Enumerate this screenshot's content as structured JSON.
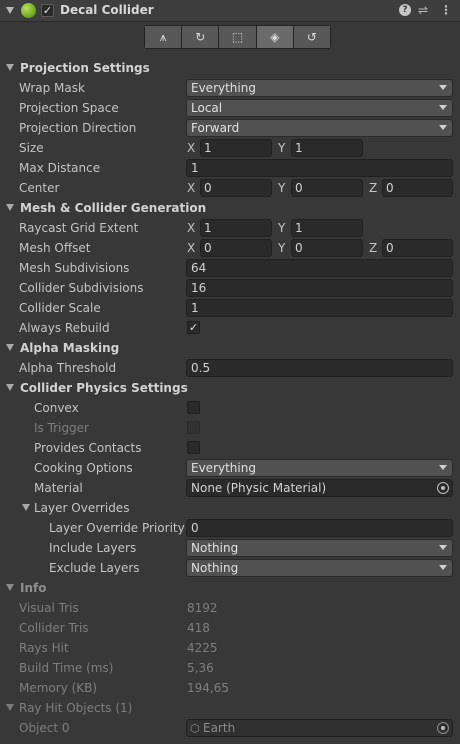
{
  "component": {
    "title": "Decal Collider",
    "enabled": true,
    "help_icon": "help-icon",
    "settings_icon": "settings-sliders-icon",
    "more_icon": "more-vertical-icon"
  },
  "toolbar": {
    "tools": [
      {
        "icon": "vertex-edit-icon",
        "glyph": "⩚"
      },
      {
        "icon": "rotate-icon",
        "glyph": "↻"
      },
      {
        "icon": "rect-tool-icon",
        "glyph": "⬚"
      },
      {
        "icon": "decal-projector-icon",
        "glyph": "◈"
      },
      {
        "icon": "refresh-icon",
        "glyph": "↺"
      }
    ]
  },
  "projection": {
    "title": "Projection Settings",
    "wrap_mask": {
      "label": "Wrap Mask",
      "value": "Everything"
    },
    "projection_space": {
      "label": "Projection Space",
      "value": "Local"
    },
    "projection_direction": {
      "label": "Projection Direction",
      "value": "Forward"
    },
    "size": {
      "label": "Size",
      "x": "1",
      "y": "1"
    },
    "max_distance": {
      "label": "Max Distance",
      "value": "1"
    },
    "center": {
      "label": "Center",
      "x": "0",
      "y": "0",
      "z": "0"
    }
  },
  "mesh": {
    "title": "Mesh & Collider Generation",
    "raycast_grid_extent": {
      "label": "Raycast Grid Extent",
      "x": "1",
      "y": "1"
    },
    "mesh_offset": {
      "label": "Mesh Offset",
      "x": "0",
      "y": "0",
      "z": "0"
    },
    "mesh_subdivisions": {
      "label": "Mesh Subdivisions",
      "value": "64"
    },
    "collider_subdivisions": {
      "label": "Collider Subdivisions",
      "value": "16"
    },
    "collider_scale": {
      "label": "Collider Scale",
      "value": "1"
    },
    "always_rebuild": {
      "label": "Always Rebuild",
      "checked": true
    }
  },
  "alpha": {
    "title": "Alpha Masking",
    "alpha_threshold": {
      "label": "Alpha Threshold",
      "value": "0.5"
    }
  },
  "physics": {
    "title": "Collider Physics Settings",
    "convex": {
      "label": "Convex",
      "checked": false
    },
    "is_trigger": {
      "label": "Is Trigger",
      "checked": false
    },
    "provides_contacts": {
      "label": "Provides Contacts",
      "checked": false
    },
    "cooking_options": {
      "label": "Cooking Options",
      "value": "Everything"
    },
    "material": {
      "label": "Material",
      "value": "None (Physic Material)"
    },
    "layer_overrides": {
      "label": "Layer Overrides",
      "priority": {
        "label": "Layer Override Priority",
        "value": "0"
      },
      "include": {
        "label": "Include Layers",
        "value": "Nothing"
      },
      "exclude": {
        "label": "Exclude Layers",
        "value": "Nothing"
      }
    }
  },
  "info": {
    "title": "Info",
    "visual_tris": {
      "label": "Visual Tris",
      "value": "8192"
    },
    "collider_tris": {
      "label": "Collider Tris",
      "value": "418"
    },
    "rays_hit": {
      "label": "Rays Hit",
      "value": "4225"
    },
    "build_time": {
      "label": "Build Time (ms)",
      "value": "5,36"
    },
    "memory": {
      "label": "Memory (KB)",
      "value": "194,65"
    },
    "ray_hit_objects": {
      "label": "Ray Hit Objects (1)",
      "items": [
        {
          "label": "Object 0",
          "value": "Earth"
        }
      ]
    }
  },
  "axis": {
    "x": "X",
    "y": "Y",
    "z": "Z"
  }
}
